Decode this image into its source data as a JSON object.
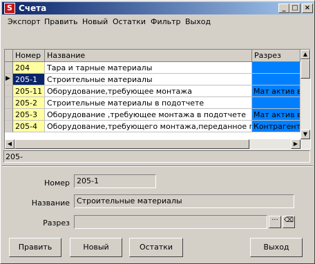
{
  "window": {
    "title": "Счета",
    "app_icon_letter": "S",
    "controls": {
      "minimize": "_",
      "maximize": "□",
      "close": "×"
    }
  },
  "menu": [
    "Экспорт",
    "Править",
    "Новый",
    "Остатки",
    "Фильтр",
    "Выход"
  ],
  "grid": {
    "columns": [
      "Номер",
      "Название",
      "Разрез"
    ],
    "rows": [
      {
        "number": "204",
        "name": "Тара и тарные материалы",
        "section": ""
      },
      {
        "number": "205-1",
        "name": "Строительные материалы",
        "section": "",
        "selected": true
      },
      {
        "number": "205-11",
        "name": "Оборудование,требующее монтажа",
        "section": "Мат актив в"
      },
      {
        "number": "205-2",
        "name": "Строительные материалы в подотчете",
        "section": ""
      },
      {
        "number": "205-3",
        "name": "Оборудование ,требующее монтажа в подотчете",
        "section": "Мат актив в"
      },
      {
        "number": "205-4",
        "name": "Оборудование,требующего монтажа,переданное подрядчи",
        "section": "Контрагенть"
      }
    ],
    "current_row_marker": "▶"
  },
  "status_text": "205-",
  "form": {
    "number_label": "Номер",
    "number_value": "205-1",
    "name_label": "Название",
    "name_value": "Строительные материалы",
    "section_label": "Разрез",
    "section_value": "",
    "browse_button": "···",
    "clear_button": "⌫"
  },
  "buttons": {
    "edit": "Править",
    "new": "Новый",
    "balances": "Остатки",
    "exit": "Выход"
  }
}
